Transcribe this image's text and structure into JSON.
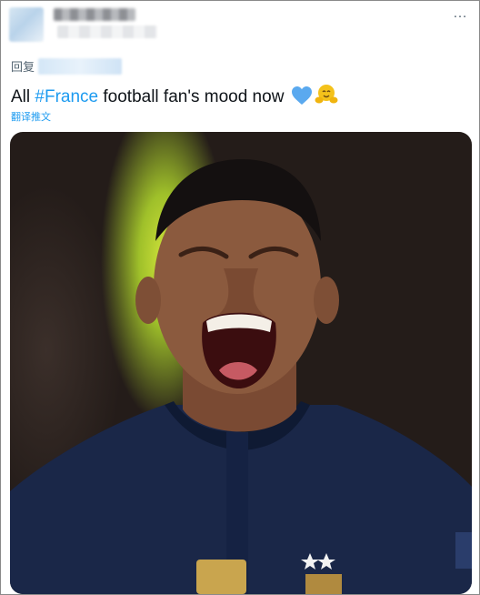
{
  "tweet": {
    "more_icon": "…",
    "reply_prefix": "回复",
    "text_before": "All ",
    "hashtag": "#France",
    "text_after": " football fan's mood now ",
    "translate_label": "翻译推文"
  },
  "icons": {
    "more": "more-dots-icon",
    "heart": "blue-heart-emoji",
    "hug": "hugging-face-emoji"
  },
  "colors": {
    "link": "#1d9bf0",
    "text": "#0f1419",
    "muted": "#536471",
    "heart": "#5aa9ef",
    "hug": "#f4c21b"
  }
}
